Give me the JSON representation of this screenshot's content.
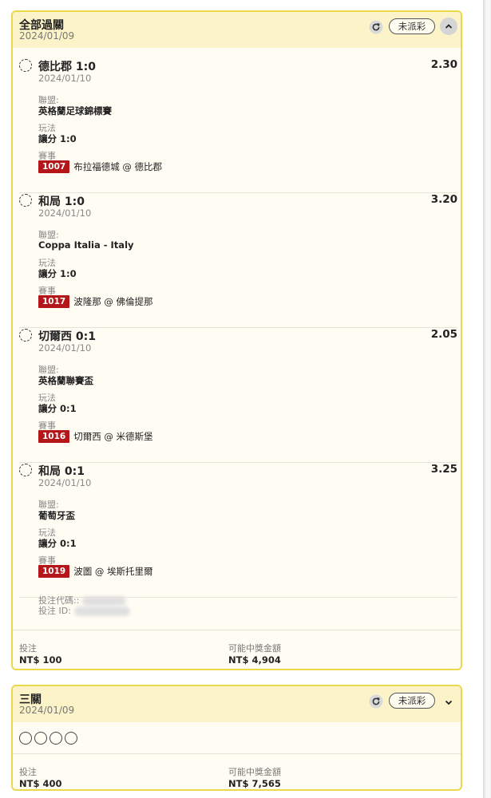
{
  "card1": {
    "title": "全部過關",
    "date": "2024/01/09",
    "badge": "未派彩",
    "selections": [
      {
        "name": "德比郡 1:0",
        "odds": "2.30",
        "date": "2024/01/10",
        "league_label": "聯盟:",
        "league": "英格蘭足球錦標賽",
        "market_label": "玩法",
        "market": "讓分 1:0",
        "event_label": "賽事",
        "code": "1007",
        "event": "布拉福德城 @ 德比郡"
      },
      {
        "name": "和局 1:0",
        "odds": "3.20",
        "date": "2024/01/10",
        "league_label": "聯盟:",
        "league": "Coppa Italia - Italy",
        "market_label": "玩法",
        "market": "讓分 1:0",
        "event_label": "賽事",
        "code": "1017",
        "event": "波隆那 @ 佛倫提那"
      },
      {
        "name": "切爾西 0:1",
        "odds": "2.05",
        "date": "2024/01/10",
        "league_label": "聯盟:",
        "league": "英格蘭聯賽盃",
        "market_label": "玩法",
        "market": "讓分 0:1",
        "event_label": "賽事",
        "code": "1016",
        "event": "切爾西 @ 米德斯堡"
      },
      {
        "name": "和局 0:1",
        "odds": "3.25",
        "date": "2024/01/10",
        "league_label": "聯盟:",
        "league": "葡萄牙盃",
        "market_label": "玩法",
        "market": "讓分 0:1",
        "event_label": "賽事",
        "code": "1019",
        "event": "波圖 @ 埃斯托里爾"
      }
    ],
    "bet_code_label": "投注代碼::",
    "bet_id_label": "投注 ID:",
    "stake_label": "投注",
    "stake": "NT$ 100",
    "payout_label": "可能中獎金額",
    "payout": "NT$ 4,904"
  },
  "card2": {
    "title": "三關",
    "date": "2024/01/09",
    "badge": "未派彩",
    "stake_label": "投注",
    "stake": "NT$ 400",
    "payout_label": "可能中獎金額",
    "payout": "NT$ 7,565"
  },
  "icons": {
    "refresh": "refresh-icon",
    "collapse": "chevron-up-icon",
    "expand": "chevron-down-icon"
  }
}
